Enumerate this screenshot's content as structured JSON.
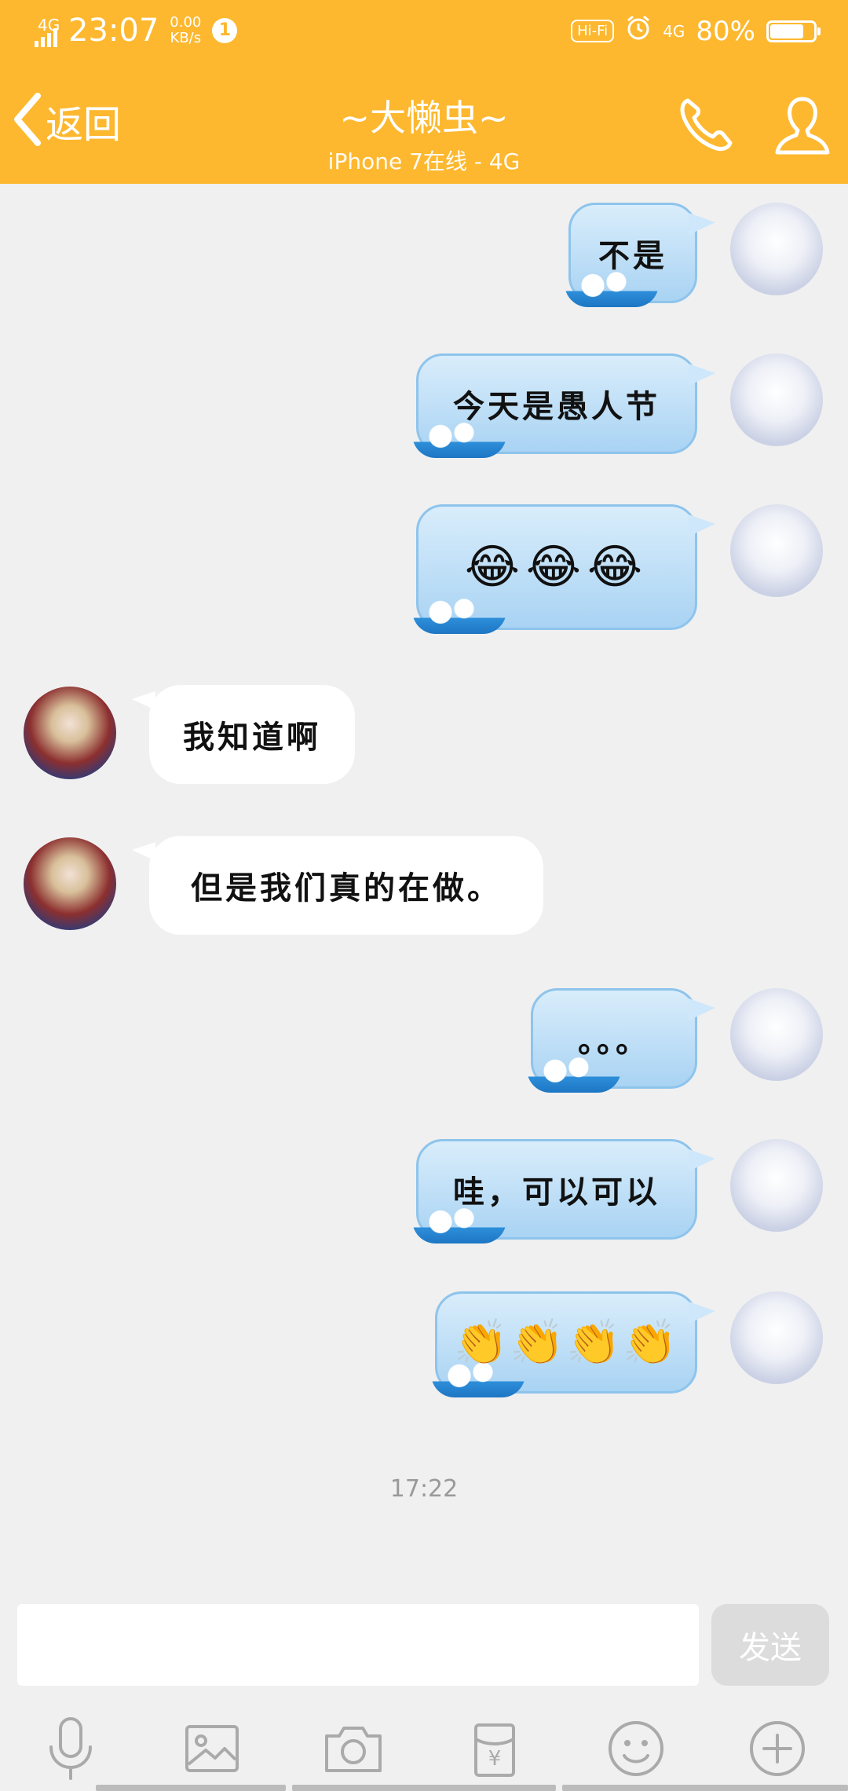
{
  "status_bar": {
    "network": "4G",
    "time": "23:07",
    "speed_value": "0.00",
    "speed_unit": "KB/s",
    "notification_count": "1",
    "hifi": "Hi-Fi",
    "network_right": "4G",
    "battery": "80%",
    "battery_level": 0.8
  },
  "header": {
    "back_label": "返回",
    "title": "~大懒虫~",
    "subtitle": "iPhone 7在线 - 4G"
  },
  "messages": [
    {
      "from": "me",
      "text": "不是"
    },
    {
      "from": "me",
      "text": "今天是愚人节"
    },
    {
      "from": "me",
      "text": "😂😂😂"
    },
    {
      "from": "other",
      "text": "我知道啊"
    },
    {
      "from": "other",
      "text": "但是我们真的在做。"
    },
    {
      "from": "me",
      "text": "。。。"
    },
    {
      "from": "me",
      "text": "哇，可以可以"
    },
    {
      "from": "me",
      "text": "👏👏👏👏"
    }
  ],
  "timestamp": "17:22",
  "input": {
    "placeholder": "",
    "send_label": "发送"
  },
  "toolbar": {
    "items": [
      "microphone-icon",
      "image-icon",
      "camera-icon",
      "red-packet-icon",
      "emoji-icon",
      "plus-icon"
    ],
    "red_packet_symbol": "¥"
  },
  "colors": {
    "accent": "#fdb82f",
    "bubble_me": "#a9d3f3",
    "bubble_other": "#ffffff",
    "background": "#f0f0f0"
  }
}
